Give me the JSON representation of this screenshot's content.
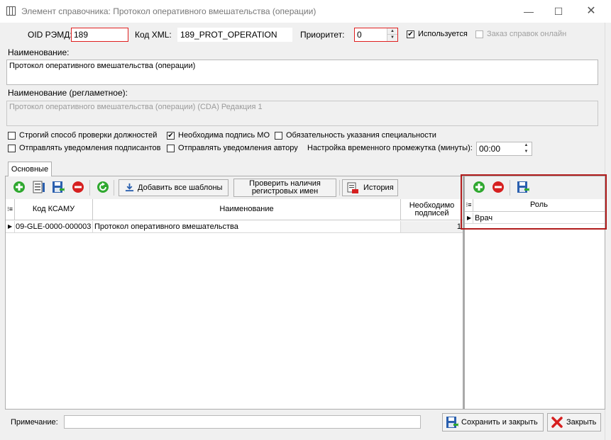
{
  "window": {
    "title": "Элемент справочника: Протокол оперативного вмешательства (операции)",
    "min_glyph": "—",
    "max_glyph": "☐",
    "close_glyph": "✕"
  },
  "form": {
    "oid_label": "OID РЭМД:",
    "oid_value": "189",
    "xml_label": "Код XML:",
    "xml_value": "189_PROT_OPERATION",
    "priority_label": "Приоритет:",
    "priority_value": "0",
    "used_label": "Используется",
    "used_checked": true,
    "online_label": "Заказ справок онлайн",
    "online_checked": false,
    "name_label": "Наименование:",
    "name_value": "Протокол оперативного вмешательства (операции)",
    "name_reg_label": "Наименование (регламетное):",
    "name_reg_value": "Протокол оперативного вмешательства (операции) (CDA) Редакция 1",
    "options": [
      {
        "label": "Строгий способ проверки должностей",
        "checked": false
      },
      {
        "label": "Необходима подпись МО",
        "checked": true
      },
      {
        "label": "Обязательность указания специальности",
        "checked": false
      },
      {
        "label": "Отправлять уведомления подписантов",
        "checked": false
      },
      {
        "label": "Отправлять уведомления автору",
        "checked": false
      }
    ],
    "time_label": "Настройка временного промежутка (минуты):",
    "time_value": "00:00"
  },
  "tabs": [
    {
      "label": "Основные"
    }
  ],
  "left_toolbar": {
    "add_all_label": "Добавить все шаблоны",
    "check_label_1": "Проверить наличия",
    "check_label_2": "регистровых имен",
    "history_label": "История"
  },
  "left_grid": {
    "columns": [
      "Код КСАМУ",
      "Наименование",
      "Необходимо подписей"
    ],
    "rows": [
      {
        "code": "09-GLE-0000-000003",
        "name": "Протокол оперативного вмешательства",
        "count": "1"
      }
    ]
  },
  "right_grid": {
    "columns": [
      "Роль"
    ],
    "rows": [
      {
        "role": "Врач"
      }
    ]
  },
  "footer": {
    "note_label": "Примечание:",
    "note_value": "",
    "save_close_label": "Сохранить и закрыть",
    "close_label": "Закрыть"
  },
  "colors": {
    "highlight": "#b11b1b",
    "add_green": "#2fa82f",
    "remove_red": "#d62020",
    "save_blue": "#2a5fae"
  }
}
